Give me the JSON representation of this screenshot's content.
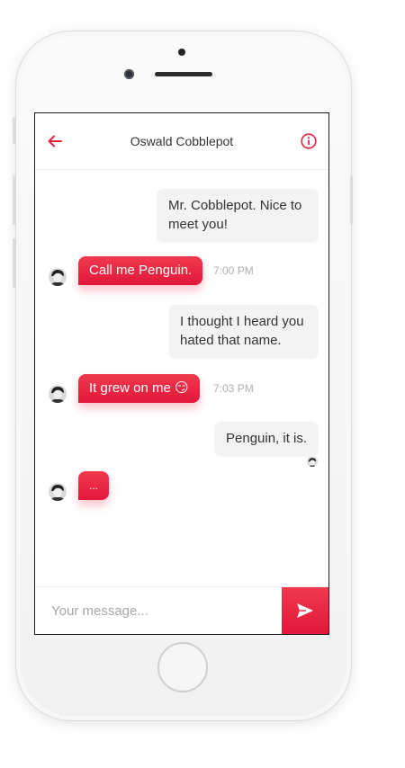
{
  "header": {
    "title": "Oswald Cobblepot"
  },
  "messages": [
    {
      "type": "sent",
      "text": "Mr. Cobblepot. Nice to meet you!"
    },
    {
      "type": "received",
      "text": "Call me Penguin.",
      "time": "7:00 PM"
    },
    {
      "type": "sent",
      "text": "I thought I heard you hated that name."
    },
    {
      "type": "received",
      "text": "It grew on me 😏",
      "time": "7:03 PM"
    },
    {
      "type": "sent",
      "text": "Penguin, it is."
    },
    {
      "type": "typing",
      "text": "..."
    }
  ],
  "composer": {
    "placeholder": "Your message..."
  },
  "colors": {
    "accent": "#e8213f",
    "sent_bubble": "#f3f3f3"
  },
  "icons": {
    "back": "arrow-left-icon",
    "info": "info-icon",
    "send": "send-icon"
  }
}
